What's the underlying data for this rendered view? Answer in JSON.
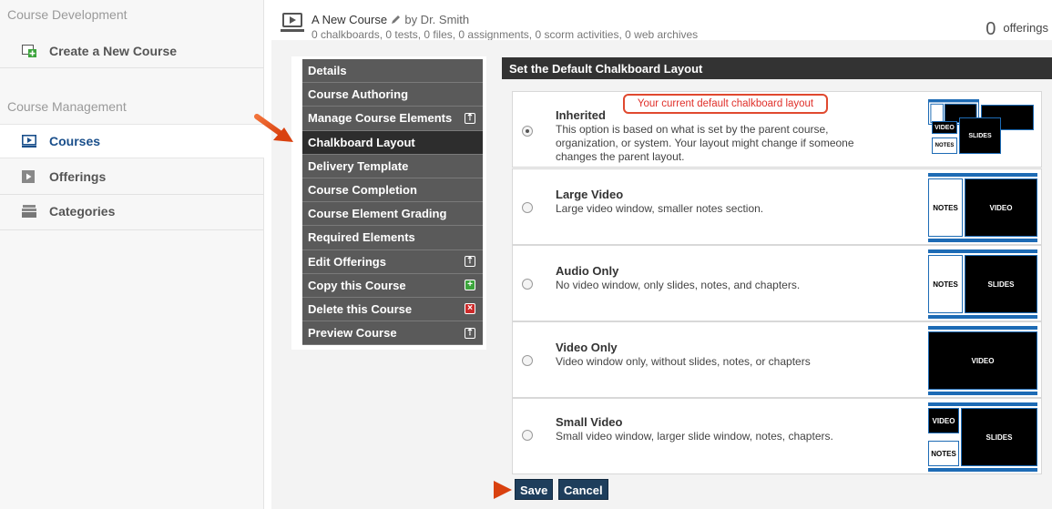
{
  "sidebar": {
    "course_development_heading": "Course Development",
    "create_course_label": "Create a New Course",
    "course_management_heading": "Course Management",
    "items": [
      {
        "label": "Courses",
        "icon": "play-icon",
        "active": true
      },
      {
        "label": "Offerings",
        "icon": "play-icon",
        "active": false
      },
      {
        "label": "Categories",
        "icon": "categories-icon",
        "active": false
      }
    ]
  },
  "header": {
    "course_name": "A New Course",
    "by_text": "by Dr. Smith",
    "stats": "0 chalkboards, 0 tests, 0 files, 0 assignments, 0 scorm activities, 0 web archives",
    "offerings_count": "0",
    "offerings_label": "offerings"
  },
  "menu": {
    "items": [
      {
        "label": "Details",
        "badge": ""
      },
      {
        "label": "Course Authoring",
        "badge": ""
      },
      {
        "label": "Manage Course Elements",
        "badge": "export"
      },
      {
        "label": "Chalkboard Layout",
        "badge": "",
        "active": true
      },
      {
        "label": "Delivery Template",
        "badge": ""
      },
      {
        "label": "Course Completion",
        "badge": ""
      },
      {
        "label": "Course Element Grading",
        "badge": ""
      },
      {
        "label": "Required Elements",
        "badge": ""
      },
      {
        "label": "Edit Offerings",
        "badge": "export"
      },
      {
        "label": "Copy this Course",
        "badge": "add"
      },
      {
        "label": "Delete this Course",
        "badge": "delete"
      },
      {
        "label": "Preview Course",
        "badge": "export"
      }
    ]
  },
  "panel": {
    "title": "Set the Default Chalkboard Layout",
    "callout": "Your current default chalkboard layout",
    "options": [
      {
        "title": "Inherited",
        "desc": "This option is based on what is set by the parent course, organization, or system. Your layout might change if someone changes the parent layout.",
        "checked": true
      },
      {
        "title": "Large Video",
        "desc": "Large video window, smaller notes section.",
        "checked": false
      },
      {
        "title": "Audio Only",
        "desc": "No video window, only slides, notes, and chapters.",
        "checked": false
      },
      {
        "title": "Video Only",
        "desc": "Video window only, without slides, notes, or chapters",
        "checked": false
      },
      {
        "title": "Small Video",
        "desc": "Small video window, larger slide window, notes, chapters.",
        "checked": false
      }
    ],
    "thumb_labels": {
      "notes": "NOTES",
      "video": "VIDEO",
      "slides": "SLIDES"
    }
  },
  "buttons": {
    "save": "Save",
    "cancel": "Cancel"
  },
  "colors": {
    "accent_blue": "#1d6bb5",
    "callout_red": "#e0302a",
    "arrow_orange": "#e8501f",
    "menu_gray": "#5a5a5a",
    "active_menu": "#2d2d2d",
    "button_navy": "#1e3e5c"
  }
}
